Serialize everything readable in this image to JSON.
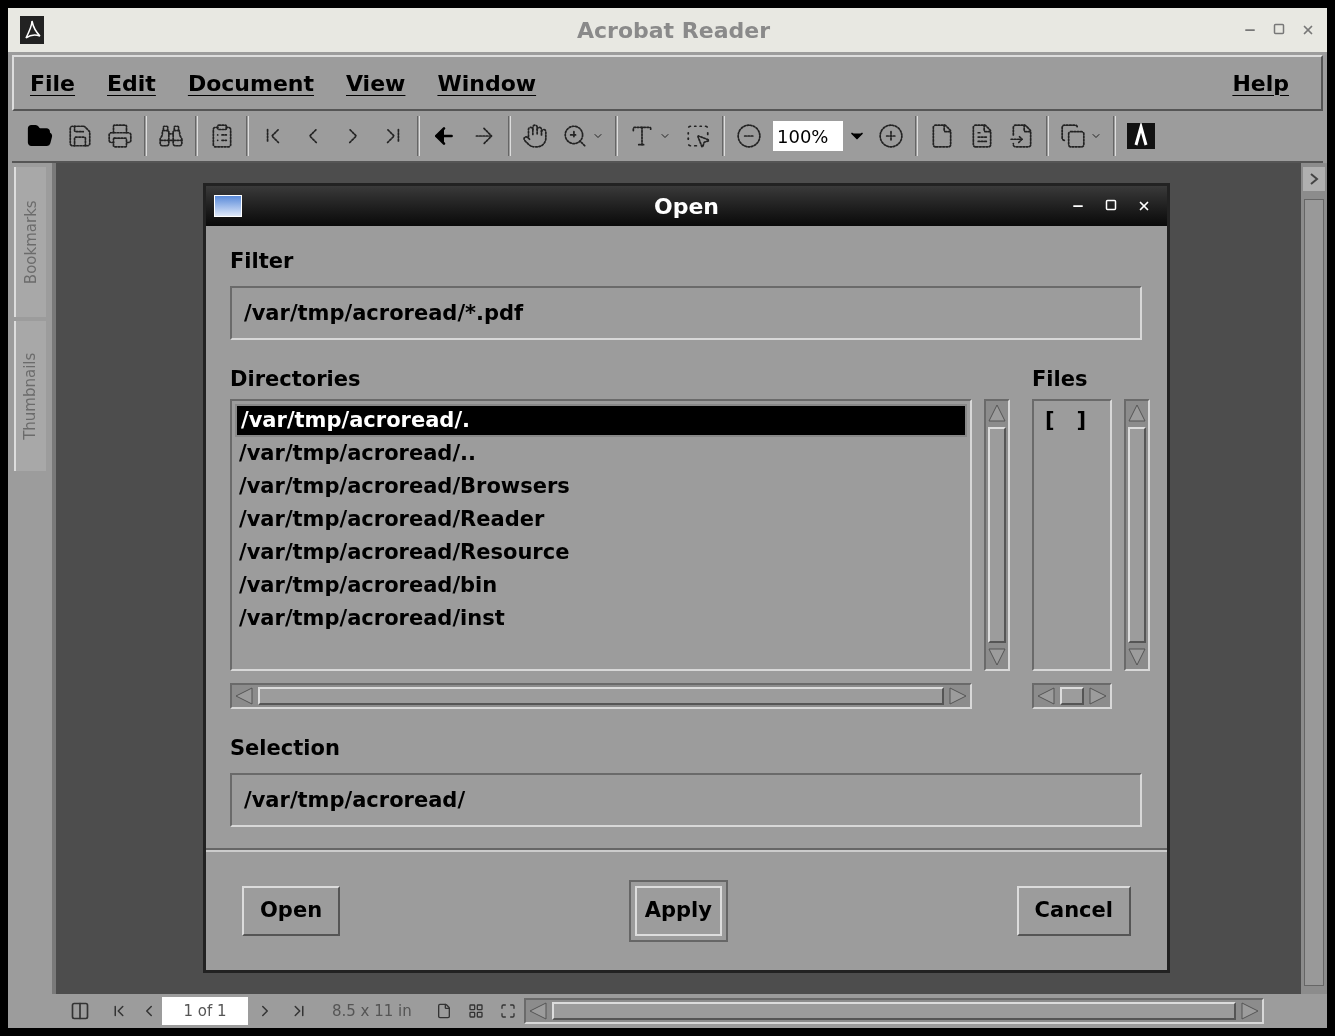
{
  "window": {
    "title": "Acrobat Reader"
  },
  "menu": [
    {
      "label": "File"
    },
    {
      "label": "Edit"
    },
    {
      "label": "Document"
    },
    {
      "label": "View"
    },
    {
      "label": "Window"
    }
  ],
  "help_menu": {
    "label": "Help"
  },
  "toolbar": [
    {
      "kind": "open",
      "disabled": false
    },
    {
      "kind": "save",
      "disabled": true
    },
    {
      "kind": "print",
      "disabled": true
    },
    {
      "kind": "sep"
    },
    {
      "kind": "find",
      "disabled": true
    },
    {
      "kind": "sep"
    },
    {
      "kind": "clipboard",
      "disabled": true
    },
    {
      "kind": "sep"
    },
    {
      "kind": "first",
      "disabled": true
    },
    {
      "kind": "prev",
      "disabled": true
    },
    {
      "kind": "next",
      "disabled": true
    },
    {
      "kind": "last",
      "disabled": true
    },
    {
      "kind": "sep"
    },
    {
      "kind": "back",
      "disabled": false
    },
    {
      "kind": "forward",
      "disabled": true
    },
    {
      "kind": "sep"
    },
    {
      "kind": "hand",
      "disabled": true
    },
    {
      "kind": "zoom",
      "disabled": true
    },
    {
      "kind": "sep"
    },
    {
      "kind": "text",
      "disabled": true
    },
    {
      "kind": "graphic",
      "disabled": true
    },
    {
      "kind": "sep"
    },
    {
      "kind": "zoom-out",
      "disabled": true
    },
    {
      "kind": "zoom-field",
      "value": "100%"
    },
    {
      "kind": "zoom-in",
      "disabled": true
    },
    {
      "kind": "sep"
    },
    {
      "kind": "actual",
      "disabled": true
    },
    {
      "kind": "fit-page",
      "disabled": true
    },
    {
      "kind": "fit-width",
      "disabled": true
    },
    {
      "kind": "sep"
    },
    {
      "kind": "reflow",
      "disabled": true
    },
    {
      "kind": "sep"
    },
    {
      "kind": "logo",
      "disabled": false
    }
  ],
  "side_tabs": [
    {
      "label": "Bookmarks",
      "disabled": true
    },
    {
      "label": "Thumbnails",
      "disabled": true
    }
  ],
  "dialog": {
    "title": "Open",
    "filter_label": "Filter",
    "filter_value": "/var/tmp/acroread/*.pdf",
    "directories_label": "Directories",
    "directories": [
      {
        "path": "/var/tmp/acroread/.",
        "selected": true
      },
      {
        "path": "/var/tmp/acroread/..",
        "selected": false
      },
      {
        "path": "/var/tmp/acroread/Browsers",
        "selected": false
      },
      {
        "path": "/var/tmp/acroread/Reader",
        "selected": false
      },
      {
        "path": "/var/tmp/acroread/Resource",
        "selected": false
      },
      {
        "path": "/var/tmp/acroread/bin",
        "selected": false
      },
      {
        "path": "/var/tmp/acroread/inst",
        "selected": false
      }
    ],
    "files_label": "Files",
    "files": [
      {
        "name": "[   ]"
      }
    ],
    "selection_label": "Selection",
    "selection_value": "/var/tmp/acroread/",
    "buttons": [
      {
        "label": "Open",
        "default": false
      },
      {
        "label": "Apply",
        "default": true
      },
      {
        "label": "Cancel",
        "default": false
      }
    ]
  },
  "status_bar": {
    "page": "1 of 1",
    "page_size": "8.5 x 11 in"
  }
}
